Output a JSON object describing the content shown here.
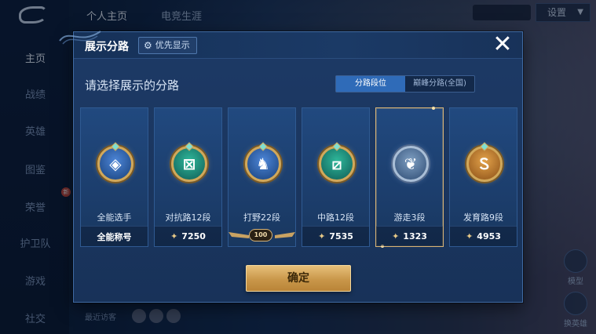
{
  "background": {
    "top_tabs": [
      "个人主页",
      "电竞生涯"
    ],
    "settings_label": "设置",
    "nav_items": [
      "主页",
      "战绩",
      "英雄",
      "图鉴",
      "荣誉",
      "护卫队",
      "游戏",
      "社交"
    ],
    "nav_badge": "新",
    "side_buttons": [
      "模型",
      "换英雄"
    ],
    "recent_label": "最近访客"
  },
  "modal": {
    "title": "展示分路",
    "priority_label": "优先显示",
    "subtitle": "请选择展示的分路",
    "segments": [
      "分路段位",
      "巅峰分路(全国)"
    ],
    "active_segment": 0,
    "cards": [
      {
        "name": "全能选手",
        "footer": "全能称号",
        "icon": "all-round-emblem",
        "score": null
      },
      {
        "name": "对抗路12段",
        "footer": "7250",
        "icon": "clash-lane-emblem",
        "score": true
      },
      {
        "name": "打野22段",
        "footer": "100",
        "icon": "jungle-emblem",
        "score": false
      },
      {
        "name": "中路12段",
        "footer": "7535",
        "icon": "mid-lane-emblem",
        "score": true
      },
      {
        "name": "游走3段",
        "footer": "1323",
        "icon": "roam-emblem",
        "score": true
      },
      {
        "name": "发育路9段",
        "footer": "4953",
        "icon": "farm-lane-emblem",
        "score": true
      }
    ],
    "selected_card": 4,
    "confirm_label": "确定"
  },
  "colors": {
    "accent_gold": "#d8b477",
    "active_tab": "#2f6bb8",
    "panel": "#1d3a66"
  }
}
